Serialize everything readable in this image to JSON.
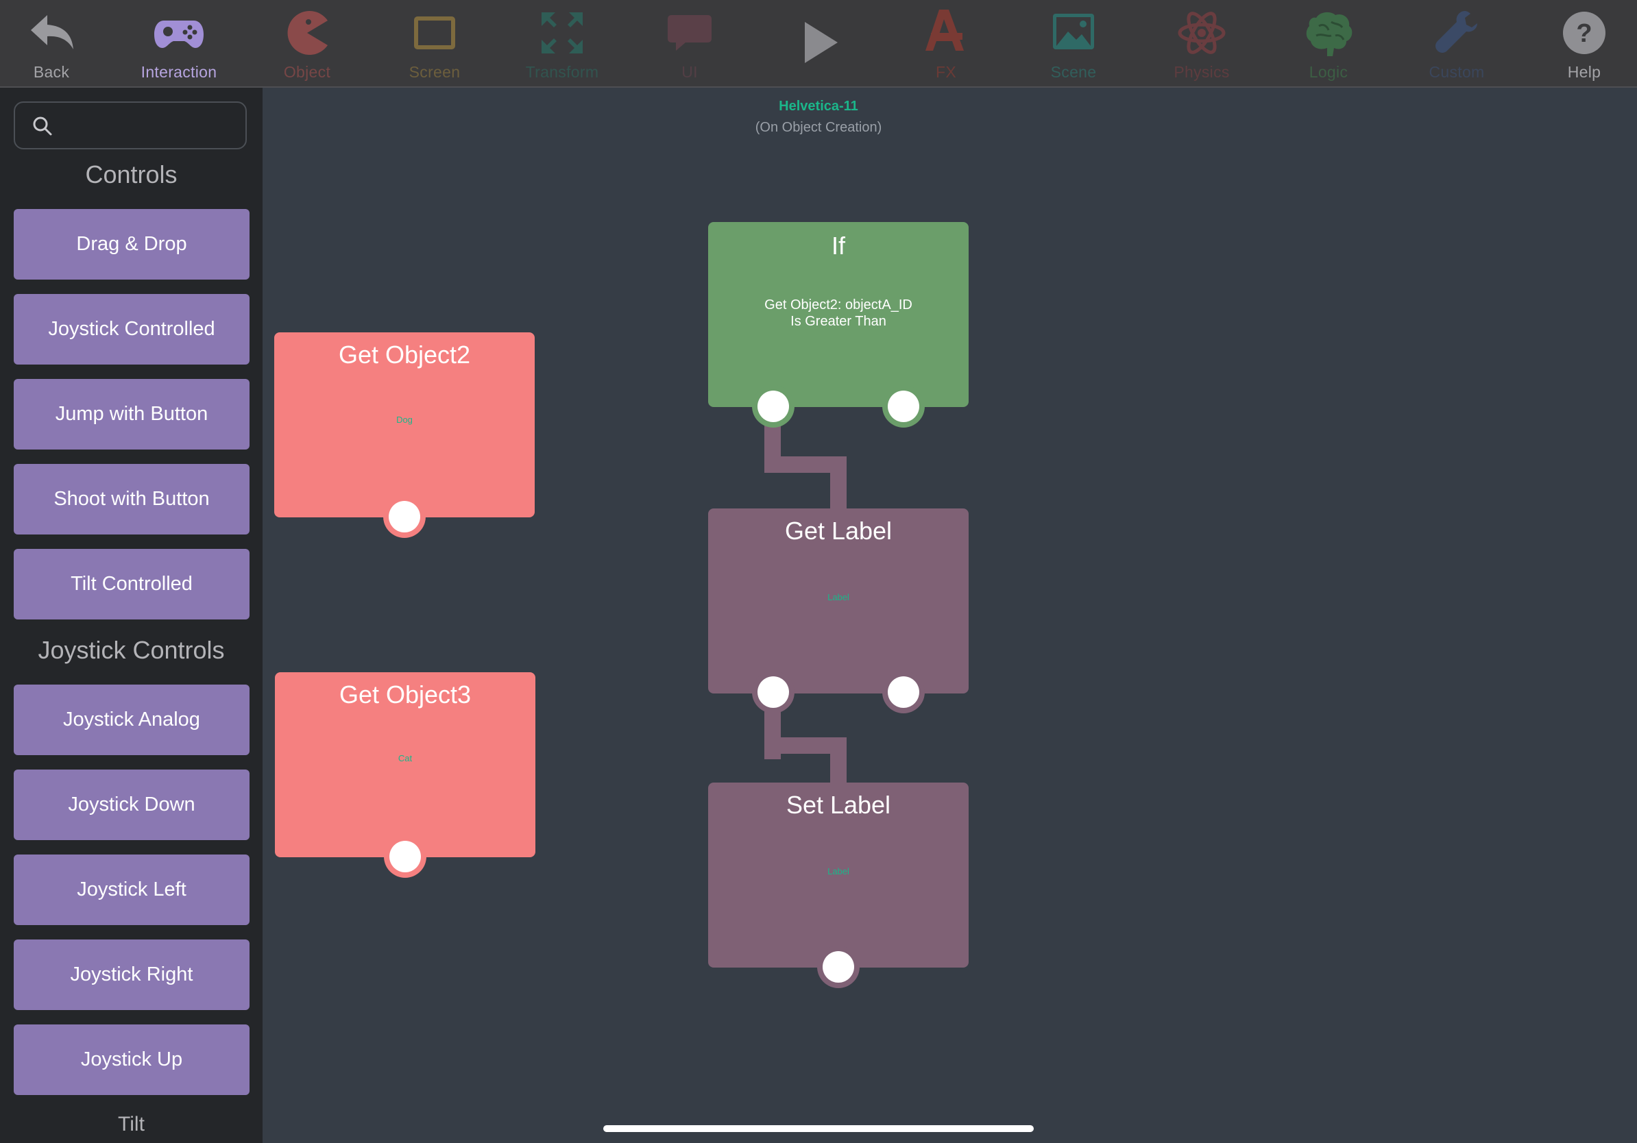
{
  "toolbar": {
    "items": [
      {
        "label": "Back",
        "icon": "back-arrow-icon",
        "color": "#9a9a9e"
      },
      {
        "label": "Interaction",
        "icon": "gamepad-icon",
        "color": "#a18fd6"
      },
      {
        "label": "Object",
        "icon": "pacman-icon",
        "color": "#8a4a4a"
      },
      {
        "label": "Screen",
        "icon": "tablet-icon",
        "color": "#7d6a3e"
      },
      {
        "label": "Transform",
        "icon": "arrows-expand-icon",
        "color": "#2f5d56"
      },
      {
        "label": "UI",
        "icon": "speech-bubble-icon",
        "color": "#5a4048"
      },
      {
        "label": "",
        "icon": "play-icon",
        "color": "#8a8a8e"
      },
      {
        "label": "FX",
        "icon": "fx-app-icon",
        "color": "#7a3a34"
      },
      {
        "label": "Scene",
        "icon": "image-icon",
        "color": "#2f6a66"
      },
      {
        "label": "Physics",
        "icon": "atom-icon",
        "color": "#6a3d40"
      },
      {
        "label": "Logic",
        "icon": "brain-icon",
        "color": "#3d6a47"
      },
      {
        "label": "Custom",
        "icon": "wrench-icon",
        "color": "#3b4a66"
      },
      {
        "label": "Help",
        "icon": "help-icon",
        "color": "#8f8f93"
      }
    ]
  },
  "sidebar": {
    "search_placeholder": "",
    "sections": [
      {
        "title": "Controls",
        "items": [
          "Drag & Drop",
          "Joystick Controlled",
          "Jump with Button",
          "Shoot with Button",
          "Tilt Controlled"
        ]
      },
      {
        "title": "Joystick Controls",
        "items": [
          "Joystick Analog",
          "Joystick Down",
          "Joystick Left",
          "Joystick Right",
          "Joystick Up"
        ]
      },
      {
        "title": "Tilt",
        "items": []
      }
    ]
  },
  "canvas": {
    "object_name": "Helvetica-11",
    "event": "(On Object Creation)",
    "nodes": {
      "if": {
        "title": "If",
        "line1": "Get Object2: objectA_ID",
        "line2": "Is Greater Than"
      },
      "get_object2": {
        "title": "Get Object2",
        "value": "Dog"
      },
      "get_object3": {
        "title": "Get Object3",
        "value": "Cat"
      },
      "get_label": {
        "title": "Get Label",
        "value": "Label"
      },
      "set_label": {
        "title": "Set Label",
        "value": "Label"
      }
    }
  },
  "colors": {
    "accent_purple": "#8a78b2",
    "object_node": "#f58080",
    "logic_node": "#6b9e6a",
    "label_node": "#7f6175",
    "value_text": "#1bb68a"
  }
}
